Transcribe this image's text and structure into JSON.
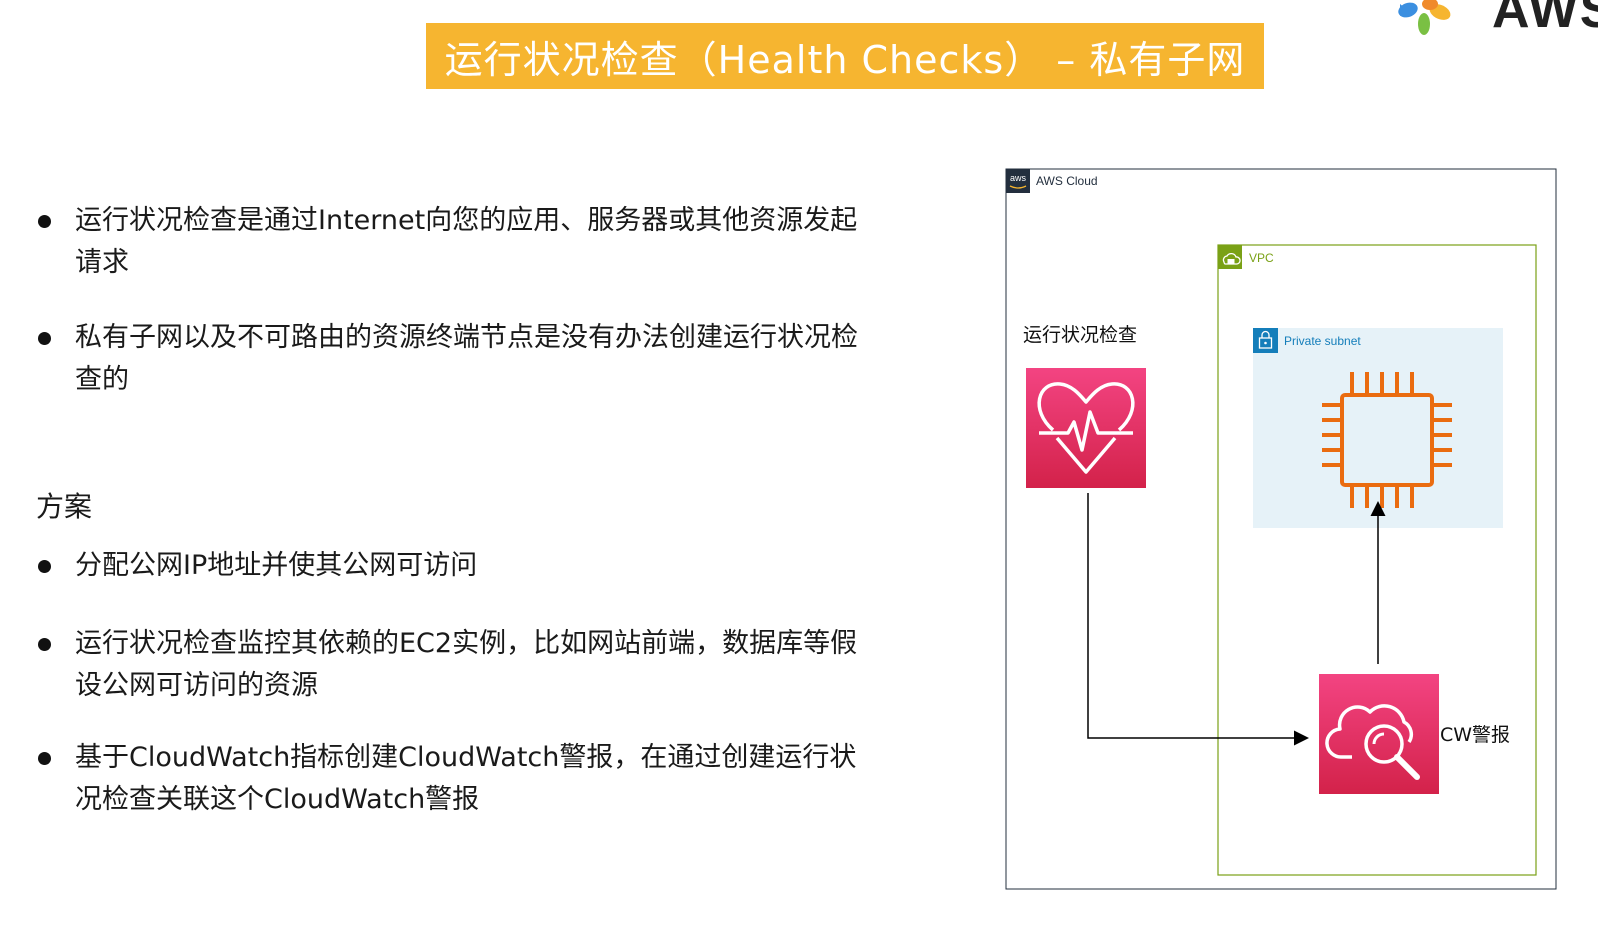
{
  "title": "运行状况检查（Health Checks） – 私有子网",
  "logo": {
    "text": "AWS",
    "petal_colors": [
      "#3b8fe0",
      "#f6b530",
      "#7ac043",
      "#f08a2b"
    ]
  },
  "bullets_top": [
    "运行状况检查是通过Internet向您的应用、服务器或其他资源发起请求",
    "私有子网以及不可路由的资源终端节点是没有办法创建运行状况检查的"
  ],
  "section_heading": "方案",
  "bullets_bottom": [
    "分配公网IP地址并使其公网可访问",
    "运行状况检查监控其依赖的EC2实例，比如网站前端，数据库等假设公网可访问的资源",
    "基于CloudWatch指标创建CloudWatch警报，在通过创建运行状况检查关联这个CloudWatch警报"
  ],
  "diagram": {
    "aws_cloud_label": "AWS Cloud",
    "aws_badge": "aws",
    "vpc_label": "VPC",
    "private_subnet_label": "Private subnet",
    "health_check_label": "运行状况检查",
    "cw_alarm_label": "CW警报",
    "colors": {
      "health_check_gradient_top": "#f34482",
      "health_check_gradient_bottom": "#d3224a",
      "vpc_border": "#7aa116",
      "subnet_fill": "#e6f2f8",
      "subnet_accent": "#147eba",
      "ec2_orange": "#ea6c10",
      "title_bar": "#f6b530"
    }
  }
}
